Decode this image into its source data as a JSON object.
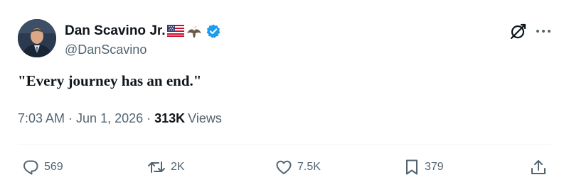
{
  "author": {
    "display_name": "Dan Scavino Jr.",
    "handle": "@DanScavino",
    "badges": [
      "us-flag-icon",
      "eagle-icon",
      "verified-icon"
    ],
    "verified_color": "#1d9bf0"
  },
  "tweet": {
    "text": "\"Every journey has an end.\""
  },
  "meta": {
    "time": "7:03 AM",
    "separator": "·",
    "date": "Jun 1, 2026",
    "views_count": "313K",
    "views_label": "Views"
  },
  "actions": {
    "reply_count": "569",
    "repost_count": "2K",
    "like_count": "7.5K",
    "bookmark_count": "379"
  },
  "icons": {
    "top_right": [
      "grok-icon",
      "more-icon"
    ],
    "actions": [
      "reply-icon",
      "repost-icon",
      "like-icon",
      "bookmark-icon",
      "share-icon"
    ]
  },
  "colors": {
    "text_primary": "#0f1419",
    "text_secondary": "#536471",
    "divider": "#eff3f4"
  }
}
